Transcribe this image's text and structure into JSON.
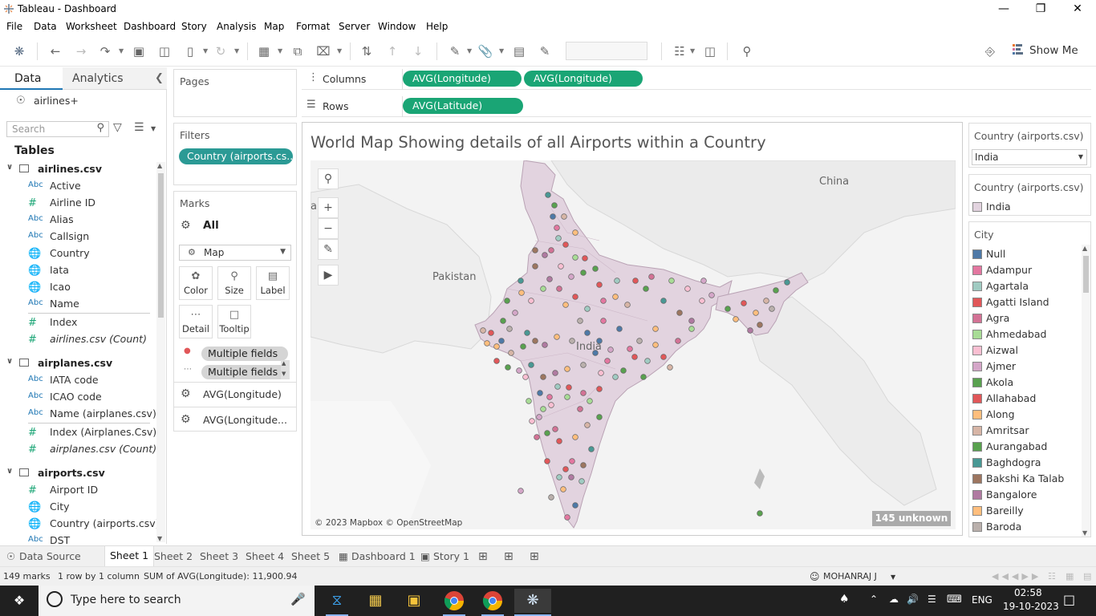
{
  "window": {
    "title": "Tableau - Dashboard"
  },
  "menu": [
    "File",
    "Data",
    "Worksheet",
    "Dashboard",
    "Story",
    "Analysis",
    "Map",
    "Format",
    "Server",
    "Window",
    "Help"
  ],
  "toolbar": {
    "show_me": "Show Me"
  },
  "datapane": {
    "tab_data": "Data",
    "tab_analytics": "Analytics",
    "datasource": "airlines+",
    "search_placeholder": "Search",
    "tables_label": "Tables",
    "tables": [
      {
        "name": "airlines.csv",
        "fields": [
          {
            "type": "Abc",
            "name": "Active"
          },
          {
            "type": "#",
            "name": "Airline ID"
          },
          {
            "type": "Abc",
            "name": "Alias"
          },
          {
            "type": "Abc",
            "name": "Callsign"
          },
          {
            "type": "globe",
            "name": "Country"
          },
          {
            "type": "globe",
            "name": "Iata"
          },
          {
            "type": "globe",
            "name": "Icao"
          },
          {
            "type": "Abc",
            "name": "Name"
          },
          {
            "type": "#",
            "name": "Index"
          },
          {
            "type": "#",
            "name": "airlines.csv (Count)"
          }
        ]
      },
      {
        "name": "airplanes.csv",
        "fields": [
          {
            "type": "Abc",
            "name": "IATA code"
          },
          {
            "type": "Abc",
            "name": "ICAO code"
          },
          {
            "type": "Abc",
            "name": "Name (airplanes.csv)"
          },
          {
            "type": "#",
            "name": "Index (Airplanes.Csv)"
          },
          {
            "type": "#",
            "name": "airplanes.csv (Count)"
          }
        ]
      },
      {
        "name": "airports.csv",
        "fields": [
          {
            "type": "#",
            "name": "Airport ID"
          },
          {
            "type": "globe",
            "name": "City"
          },
          {
            "type": "globe",
            "name": "Country (airports.csv)"
          },
          {
            "type": "Abc",
            "name": "DST"
          }
        ]
      }
    ]
  },
  "shelves": {
    "pages_title": "Pages",
    "filters_title": "Filters",
    "filter_pill": "Country (airports.cs..",
    "marks_title": "Marks",
    "marks_all": "All",
    "mark_type": "Map",
    "mark_buttons": {
      "color": "Color",
      "size": "Size",
      "label": "Label",
      "detail": "Detail",
      "tooltip": "Tooltip"
    },
    "mark_fields": [
      "Multiple fields",
      "Multiple fields"
    ],
    "mark_layers": [
      "AVG(Longitude)",
      "AVG(Longitude..."
    ],
    "columns_label": "Columns",
    "columns_pills": [
      "AVG(Longitude)",
      "AVG(Longitude)"
    ],
    "rows_label": "Rows",
    "rows_pills": [
      "AVG(Latitude)"
    ]
  },
  "view": {
    "title": "World Map Showing details of all Airports within a Country",
    "map_labels": {
      "china": "China",
      "pakistan": "Pakistan",
      "india": "India",
      "partial": "ar"
    },
    "attribution": "© 2023 Mapbox © OpenStreetMap",
    "unknown_badge": "145 unknown",
    "colors": {
      "india_fill": "#e2d3df",
      "india_border": "#b9a2b4",
      "land": "#efefef"
    }
  },
  "legends": {
    "filter_title": "Country (airports.csv)",
    "filter_value": "India",
    "color_title": "Country (airports.csv)",
    "color_item": "India",
    "city_title": "City",
    "cities": [
      {
        "name": "Null",
        "color": "#4e79a7"
      },
      {
        "name": "Adampur",
        "color": "#e377a0"
      },
      {
        "name": "Agartala",
        "color": "#a0cbc2"
      },
      {
        "name": "Agatti Island",
        "color": "#e15759"
      },
      {
        "name": "Agra",
        "color": "#d37295"
      },
      {
        "name": "Ahmedabad",
        "color": "#a8dc96"
      },
      {
        "name": "Aizwal",
        "color": "#fabfd2"
      },
      {
        "name": "Ajmer",
        "color": "#d4a6c8"
      },
      {
        "name": "Akola",
        "color": "#59a14f"
      },
      {
        "name": "Allahabad",
        "color": "#e15759"
      },
      {
        "name": "Along",
        "color": "#ffbe7d"
      },
      {
        "name": "Amritsar",
        "color": "#d7b5a6"
      },
      {
        "name": "Aurangabad",
        "color": "#59a14f"
      },
      {
        "name": "Baghdogra",
        "color": "#499894"
      },
      {
        "name": "Bakshi Ka Talab",
        "color": "#9d7660"
      },
      {
        "name": "Bangalore",
        "color": "#b07aa1"
      },
      {
        "name": "Bareilly",
        "color": "#ffbe7d"
      },
      {
        "name": "Baroda",
        "color": "#bab0ac"
      }
    ]
  },
  "sheets": {
    "data_source": "Data Source",
    "tabs": [
      "Sheet 1",
      "Sheet 2",
      "Sheet 3",
      "Sheet 4",
      "Sheet 5",
      "Dashboard 1",
      "Story 1"
    ]
  },
  "status": {
    "marks": "149 marks",
    "rows_cols": "1 row by 1 column",
    "sum": "SUM of AVG(Longitude): 11,900.94",
    "user": "MOHANRAJ J"
  },
  "taskbar": {
    "search_placeholder": "Type here to search",
    "lang": "ENG",
    "time": "02:58",
    "date": "19-10-2023"
  }
}
